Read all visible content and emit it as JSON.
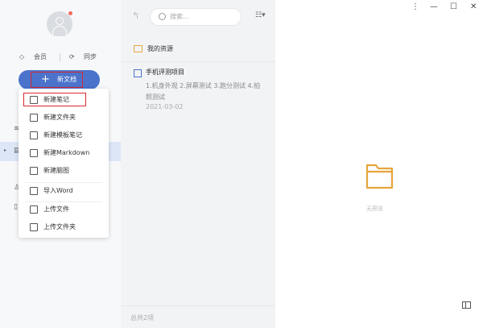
{
  "sidebar": {
    "member_label": "会员",
    "sync_label": "同步",
    "new_doc_label": "新文档"
  },
  "new_menu": {
    "items": [
      {
        "label": "新建笔记",
        "icon": "new-note-icon"
      },
      {
        "label": "新建文件夹",
        "icon": "new-folder-icon"
      },
      {
        "label": "新建模板笔记",
        "icon": "template-note-icon"
      },
      {
        "label": "新建Markdown",
        "icon": "markdown-icon"
      },
      {
        "label": "新建脑图",
        "icon": "mindmap-icon"
      },
      {
        "label": "导入Word",
        "icon": "import-word-icon"
      },
      {
        "label": "上传文件",
        "icon": "upload-file-icon"
      },
      {
        "label": "上传文件夹",
        "icon": "upload-folder-icon"
      }
    ]
  },
  "middle": {
    "search_placeholder": "搜索...",
    "folder_label": "我的资源",
    "note": {
      "title": "手机评测项目",
      "snippet": "1.机身外观 2.屏幕测试 3.跑分测试 4.拍照测试",
      "date": "2021-03-02"
    },
    "count": "总共2项"
  },
  "right": {
    "empty_text": "无预览"
  },
  "colors": {
    "accent": "#4b73cc",
    "highlight_box": "#d8292f",
    "folder": "#e7a43b"
  }
}
